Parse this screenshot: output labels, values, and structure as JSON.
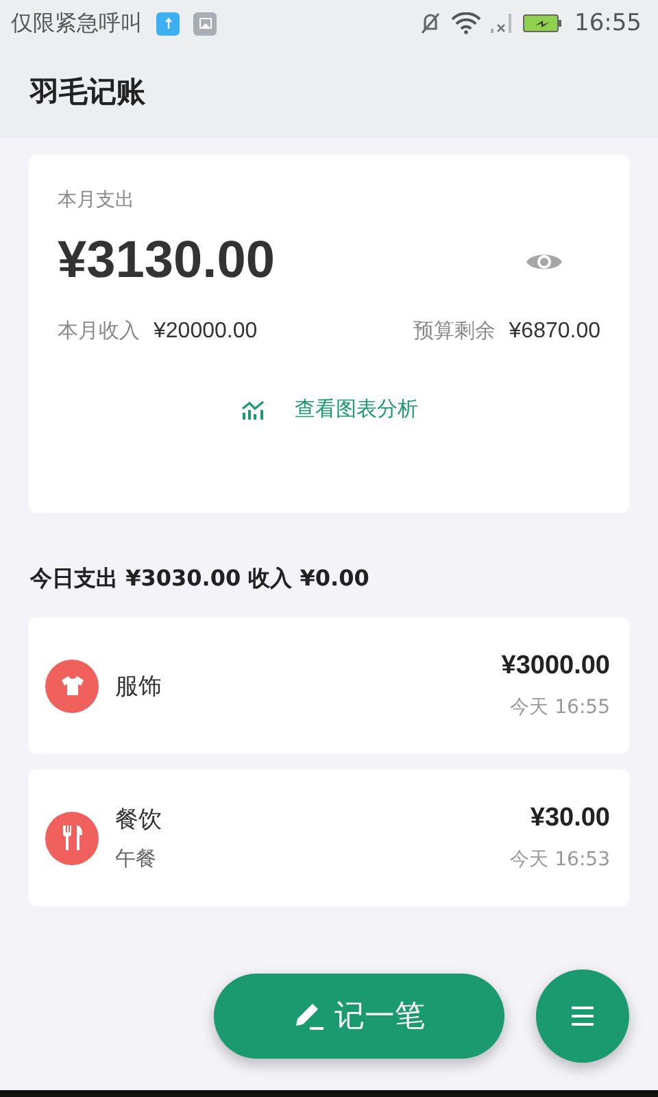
{
  "status_bar": {
    "notification_text": "仅限紧急呼叫",
    "time": "16:55"
  },
  "app_bar": {
    "title": "羽毛记账"
  },
  "summary": {
    "label": "本月支出",
    "amount": "¥3130.00",
    "income_label": "本月收入",
    "income": "¥20000.00",
    "budget_label": "预算剩余",
    "budget": "¥6870.00",
    "chart_link": "查看图表分析"
  },
  "today": {
    "text": "今日支出 ¥3030.00 收入 ¥0.00"
  },
  "records": [
    {
      "kind": "clothing",
      "category": "服饰",
      "amount": "¥3000.00",
      "time": "今天 16:55"
    },
    {
      "kind": "food",
      "category": "餐饮",
      "note": "午餐",
      "amount": "¥30.00",
      "time": "今天 16:53"
    }
  ],
  "add_button": {
    "label": "记一笔"
  }
}
